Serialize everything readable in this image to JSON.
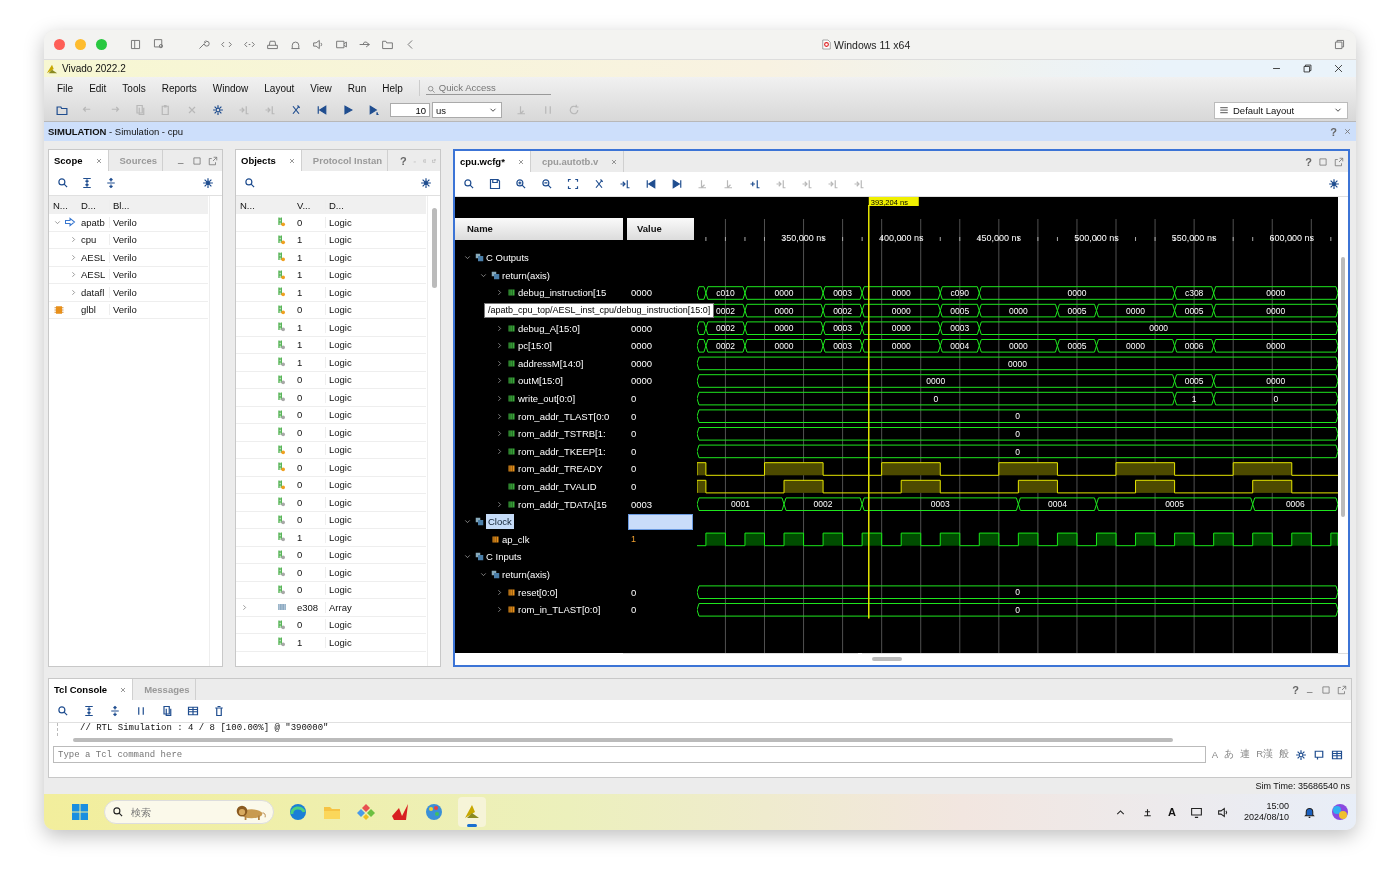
{
  "host": {
    "title": "Windows 11 x64"
  },
  "app": {
    "title": "Vivado 2022.2"
  },
  "menu": [
    "File",
    "Edit",
    "Tools",
    "Reports",
    "Window",
    "Layout",
    "View",
    "Run",
    "Help"
  ],
  "quick_access": {
    "placeholder": "Quick Access"
  },
  "main_toolbar": [
    {
      "disabled": false
    },
    {
      "disabled": true
    },
    {
      "disabled": true
    },
    {
      "disabled": true
    },
    {
      "disabled": true
    },
    {
      "disabled": true
    },
    {
      "disabled": false
    },
    {
      "disabled": true
    },
    {
      "disabled": true
    },
    {
      "disabled": false
    },
    {
      "disabled": false
    },
    {
      "disabled": false
    },
    {
      "disabled": false
    }
  ],
  "run_time": {
    "value": "10",
    "unit": "us"
  },
  "run_toolbar": [
    {
      "disabled": true
    },
    {
      "disabled": true
    },
    {
      "disabled": true
    }
  ],
  "layout_select": "Default Layout",
  "flow_header": {
    "text": "**SIMULATION** - Simulation - cpu",
    "help": "?"
  },
  "scope": {
    "tabs": [
      {
        "label": "Scope",
        "selected": true
      },
      {
        "label": "Sources",
        "selected": false
      }
    ],
    "columns": [
      "N...",
      "D...",
      "Bl..."
    ],
    "rows": [
      {
        "unit": "apatb",
        "block": "Verilo",
        "kind": "top",
        "expanded": true,
        "children": [
          {
            "unit": "cpu",
            "block": "Verilo",
            "expanded": false
          },
          {
            "unit": "AESL",
            "block": "Verilo",
            "expanded": false
          },
          {
            "unit": "AESL",
            "block": "Verilo",
            "expanded": false
          },
          {
            "unit": "datafl",
            "block": "Verilo",
            "expanded": false
          }
        ]
      },
      {
        "unit": "glbl",
        "block": "Verilo",
        "kind": "package"
      }
    ]
  },
  "objects": {
    "tabs": [
      {
        "label": "Objects",
        "selected": true
      },
      {
        "label": "Protocol Instan",
        "selected": false
      }
    ],
    "help": "?",
    "columns": [
      "N...",
      "V...",
      "D..."
    ],
    "rows": [
      {
        "value": "0",
        "type": "Logic",
        "kind": "logic",
        "port": true
      },
      {
        "value": "1",
        "type": "Logic",
        "kind": "logic",
        "port": true
      },
      {
        "value": "1",
        "type": "Logic",
        "kind": "logic",
        "port": true
      },
      {
        "value": "1",
        "type": "Logic",
        "kind": "logic",
        "port": true
      },
      {
        "value": "1",
        "type": "Logic",
        "kind": "logic",
        "port": true
      },
      {
        "value": "0",
        "type": "Logic",
        "kind": "logic",
        "port": true
      },
      {
        "value": "1",
        "type": "Logic",
        "kind": "logic",
        "port": false
      },
      {
        "value": "1",
        "type": "Logic",
        "kind": "logic",
        "port": false
      },
      {
        "value": "1",
        "type": "Logic",
        "kind": "logic",
        "port": false
      },
      {
        "value": "0",
        "type": "Logic",
        "kind": "logic",
        "port": false
      },
      {
        "value": "0",
        "type": "Logic",
        "kind": "logic",
        "port": false
      },
      {
        "value": "0",
        "type": "Logic",
        "kind": "logic",
        "port": false
      },
      {
        "value": "0",
        "type": "Logic",
        "kind": "logic",
        "port": false
      },
      {
        "value": "0",
        "type": "Logic",
        "kind": "logic",
        "port": true
      },
      {
        "value": "0",
        "type": "Logic",
        "kind": "logic",
        "port": true
      },
      {
        "value": "0",
        "type": "Logic",
        "kind": "logic",
        "port": true
      },
      {
        "value": "0",
        "type": "Logic",
        "kind": "logic",
        "port": false
      },
      {
        "value": "0",
        "type": "Logic",
        "kind": "logic",
        "port": false
      },
      {
        "value": "1",
        "type": "Logic",
        "kind": "logic",
        "port": false
      },
      {
        "value": "0",
        "type": "Logic",
        "kind": "logic",
        "port": false
      },
      {
        "value": "0",
        "type": "Logic",
        "kind": "logic",
        "port": false
      },
      {
        "value": "0",
        "type": "Logic",
        "kind": "logic",
        "port": false
      },
      {
        "value": "e308",
        "type": "Array",
        "kind": "array",
        "expanded": false
      },
      {
        "value": "0",
        "type": "Logic",
        "kind": "logic",
        "port": false
      },
      {
        "value": "1",
        "type": "Logic",
        "kind": "logic",
        "port": false
      }
    ]
  },
  "waveform": {
    "tabs": [
      {
        "label": "cpu.wcfg*",
        "selected": true
      },
      {
        "label": "cpu.autotb.v",
        "selected": false
      }
    ],
    "help": "?",
    "toolbar": [
      {
        "disabled": false
      },
      {
        "disabled": false
      },
      {
        "disabled": false
      },
      {
        "disabled": false
      },
      {
        "disabled": false
      },
      {
        "disabled": false
      },
      {
        "disabled": false
      },
      {
        "disabled": false
      },
      {
        "disabled": false
      },
      {
        "disabled": true
      },
      {
        "disabled": true
      },
      {
        "disabled": false
      },
      {
        "disabled": true
      },
      {
        "disabled": true
      },
      {
        "disabled": true
      },
      {
        "disabled": true
      }
    ],
    "columns": [
      "Name",
      "Value"
    ],
    "cursor": "393,204 ns",
    "ruler": [
      "350,000 ns",
      "400,000 ns",
      "450,000 ns",
      "500,000 ns",
      "550,000 ns",
      "600,000 ns"
    ],
    "rows": [
      {
        "name": "C Outputs",
        "kind": "group",
        "expanded": true,
        "selected": false,
        "children": [
          {
            "name": "return(axis)",
            "kind": "group",
            "expanded": true,
            "selected": false,
            "children": [
              {
                "name": "debug_instruction[15",
                "kind": "outbus",
                "expanded": false,
                "selected": false,
                "value": "0000",
                "wave": [
                  "c010",
                  "0000",
                  "0003",
                  "0000",
                  "c090",
                  "0000",
                  "c308",
                  "0000"
                ]
              },
              {
                "kind": "outbus",
                "selected": false,
                "tooltip": "/apatb_cpu_top/AESL_inst_cpu/debug_instruction[15:0]",
                "wave": [
                  "0002",
                  "0000",
                  "0002",
                  "0000",
                  "0005",
                  "0000",
                  "0005",
                  "0000",
                  "0005",
                  "0000"
                ]
              },
              {
                "name": "debug_A[15:0]",
                "kind": "outbus",
                "expanded": false,
                "selected": false,
                "value": "0000",
                "wave": [
                  "0002",
                  "0000",
                  "0003",
                  "0000",
                  "0003",
                  "0000"
                ]
              },
              {
                "name": "pc[15:0]",
                "kind": "outbus",
                "expanded": false,
                "selected": false,
                "value": "0000",
                "wave": [
                  "0002",
                  "0000",
                  "0003",
                  "0000",
                  "0004",
                  "0000",
                  "0005",
                  "0000",
                  "0006",
                  "0000"
                ]
              },
              {
                "name": "addressM[14:0]",
                "kind": "outbus",
                "expanded": false,
                "selected": false,
                "value": "0000",
                "wave": [
                  "0000"
                ]
              },
              {
                "name": "outM[15:0]",
                "kind": "outbus",
                "expanded": false,
                "selected": false,
                "value": "0000",
                "wave": [
                  "0000",
                  "0005",
                  "0000"
                ]
              },
              {
                "name": "write_out[0:0]",
                "kind": "outbus",
                "expanded": false,
                "selected": false,
                "value": "0",
                "wave": [
                  "0",
                  "1",
                  "0"
                ]
              },
              {
                "name": "rom_addr_TLAST[0:0",
                "kind": "outbus",
                "expanded": false,
                "selected": false,
                "value": "0",
                "wave": [
                  "0"
                ]
              },
              {
                "name": "rom_addr_TSTRB[1:",
                "kind": "outbus",
                "expanded": false,
                "selected": false,
                "value": "0",
                "wave": [
                  "0"
                ]
              },
              {
                "name": "rom_addr_TKEEP[1:",
                "kind": "outbus",
                "expanded": false,
                "selected": false,
                "value": "0",
                "wave": [
                  "0"
                ]
              },
              {
                "name": "rom_addr_TREADY",
                "kind": "inbit",
                "selected": false,
                "value": "0"
              },
              {
                "name": "rom_addr_TVALID",
                "kind": "outbit",
                "selected": false,
                "value": "0"
              },
              {
                "name": "rom_addr_TDATA[15",
                "kind": "outbus",
                "expanded": false,
                "selected": false,
                "value": "0003",
                "wave": [
                  "0001",
                  "0002",
                  "0003",
                  "0004",
                  "0005",
                  "0006"
                ]
              }
            ]
          }
        ]
      },
      {
        "name": "Clock",
        "kind": "group",
        "expanded": true,
        "selected": true,
        "children": [
          {
            "name": "ap_clk",
            "kind": "clock",
            "selected": false,
            "value": "1"
          }
        ]
      },
      {
        "name": "C Inputs",
        "kind": "group",
        "expanded": true,
        "selected": false,
        "children": [
          {
            "name": "return(axis)",
            "kind": "group",
            "expanded": true,
            "selected": false,
            "children": [
              {
                "name": "reset[0:0]",
                "kind": "inbus",
                "expanded": false,
                "selected": false,
                "value": "0",
                "wave": [
                  "0"
                ]
              },
              {
                "name": "rom_in_TLAST[0:0]",
                "kind": "inbus",
                "expanded": false,
                "selected": false,
                "value": "0",
                "wave": [
                  "0"
                ]
              }
            ]
          }
        ]
      }
    ]
  },
  "console": {
    "tabs": [
      {
        "label": "Tcl Console",
        "selected": true
      },
      {
        "label": "Messages",
        "selected": false
      }
    ],
    "help": "?",
    "lines": [
      "// RTL Simulation : 4 / 8 [100.00%] @ \"390000\""
    ],
    "placeholder": "Type a Tcl command here",
    "ime": [
      "A",
      "あ",
      "連",
      "R漢",
      "般"
    ]
  },
  "status": "Sim Time: 35686540 ns",
  "taskbar": {
    "search_placeholder": "検索",
    "ime": "A",
    "time": "15:00",
    "date": "2024/08/10"
  }
}
